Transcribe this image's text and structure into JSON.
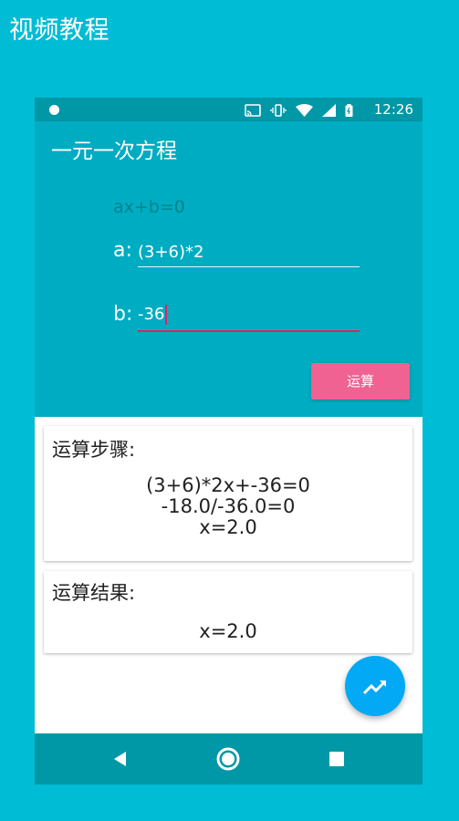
{
  "page": {
    "title": "视频教程"
  },
  "status_bar": {
    "time": "12:26",
    "icons": [
      "notification-dot-icon",
      "cast-icon",
      "vibrate-icon",
      "wifi-icon",
      "signal-icon",
      "battery-icon"
    ]
  },
  "app_bar": {
    "title": "一元一次方程"
  },
  "form": {
    "formula": "ax+b=0",
    "a_label": "a:",
    "a_value": "(3+6)*2",
    "b_label": "b:",
    "b_value": "-36",
    "calc_button": "运算"
  },
  "steps_card": {
    "title": "运算步骤:",
    "lines": [
      "(3+6)*2x+-36=0",
      "-18.0/-36.0=0",
      "x=2.0"
    ]
  },
  "result_card": {
    "title": "运算结果:",
    "value": "x=2.0"
  },
  "fab": {
    "icon": "trending-up-icon"
  },
  "nav_bar": {
    "icons": [
      "back-icon",
      "home-icon",
      "recents-icon"
    ]
  },
  "colors": {
    "background": "#00bcd4",
    "status_bar": "#0097a7",
    "app_bar": "#00acc1",
    "button_pink": "#f06292",
    "accent_pink": "#e91e63",
    "fab_blue": "#03a9f4",
    "formula_text": "#00838f"
  }
}
